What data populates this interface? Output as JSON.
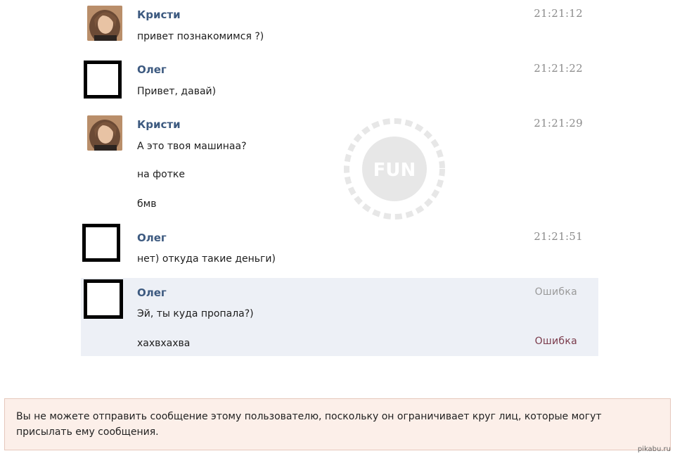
{
  "messages": [
    {
      "author": "Кристи",
      "time": "21:21:12",
      "lines": [
        "привет познакомимся ?)"
      ]
    },
    {
      "author": "Олег",
      "time": "21:21:22",
      "lines": [
        "Привет, давай)"
      ]
    },
    {
      "author": "Кристи",
      "time": "21:21:29",
      "lines": [
        "А это твоя машинаа?",
        "на фотке",
        "бмв"
      ]
    },
    {
      "author": "Олег",
      "time": "21:21:51",
      "lines": [
        "нет) откуда такие деньги)"
      ]
    },
    {
      "author": "Олег",
      "status": [
        "Ошибка",
        "Ошибка"
      ],
      "lines": [
        "Эй, ты куда пропала?)",
        "хахвхахва"
      ]
    }
  ],
  "watermark_text": "FUN",
  "banner_text": "Вы не можете отправить сообщение этому пользователю, поскольку он ограничивает круг лиц, которые могут присылать ему сообщения.",
  "site_mark": "pikabu.ru",
  "colors": {
    "author": "#3d5a80",
    "unsent_bg": "#edf0f6",
    "banner_bg": "#fcefe9",
    "banner_border": "#e6c8bc"
  }
}
